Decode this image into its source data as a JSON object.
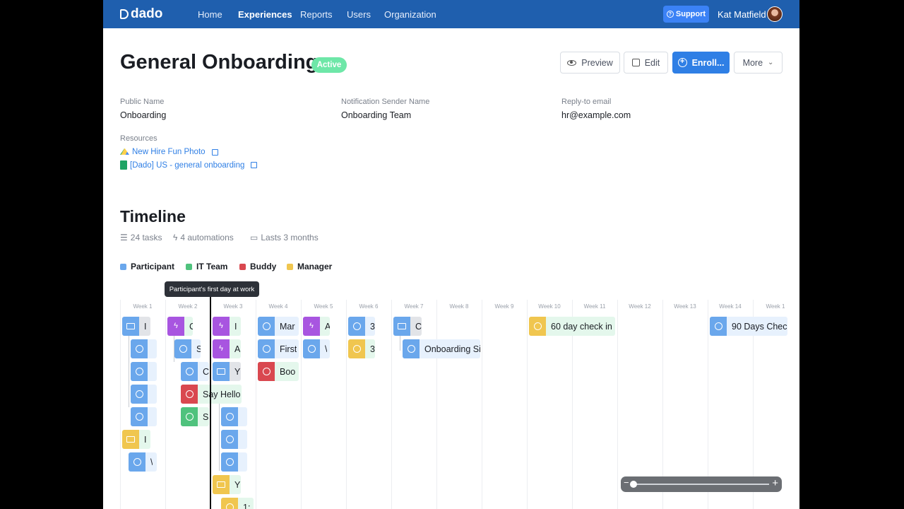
{
  "nav": {
    "brand": "dado",
    "links": [
      "Home",
      "Experiences",
      "Reports",
      "Users",
      "Organization"
    ],
    "active": "Experiences",
    "support": "Support",
    "user": "Kat Matfield"
  },
  "header": {
    "title": "General Onboarding",
    "status": "Active",
    "buttons": {
      "preview": "Preview",
      "edit": "Edit",
      "enroll": "Enroll...",
      "more": "More"
    }
  },
  "details": {
    "public_name_label": "Public Name",
    "public_name": "Onboarding",
    "sender_label": "Notification Sender Name",
    "sender": "Onboarding Team",
    "reply_label": "Reply-to email",
    "reply": "hr@example.com",
    "resources_label": "Resources",
    "resources": [
      "New Hire Fun Photo",
      "[Dado] US - general onboarding"
    ]
  },
  "timeline": {
    "title": "Timeline",
    "tasks_count": "24 tasks",
    "automations": "4 automations",
    "duration": "Lasts 3 months",
    "legend": [
      {
        "label": "Participant",
        "color": "#6aa7ec"
      },
      {
        "label": "IT Team",
        "color": "#4fc27d"
      },
      {
        "label": "Buddy",
        "color": "#d9484f"
      },
      {
        "label": "Manager",
        "color": "#f0c64f"
      }
    ],
    "today_tooltip": "Participant's first day at work",
    "weeks": [
      "Week 1",
      "Week 2",
      "Week 3",
      "Week 4",
      "Week 5",
      "Week 6",
      "Week 7",
      "Week 8",
      "Week 9",
      "Week 10",
      "Week 11",
      "Week 12",
      "Week 13",
      "Week 14",
      "Week 1"
    ],
    "task_labels": {
      "w1_mail": "I",
      "w1_mgr": "I",
      "w1_part": "\\",
      "w2_auto": "C",
      "w2_task1": "S",
      "w2_task2": "C",
      "w2_buddy": "Say Hello",
      "w2_it": "S",
      "w3_auto1": "I",
      "w3_auto2": "A",
      "w3_mail": "Y",
      "w3_mgr": "Y",
      "w3_last": "1:",
      "w4_a": "Mar",
      "w4_b": "First",
      "w4_c": "Boo",
      "w5_auto": "A",
      "w5_task": "\\",
      "w6_a": "3",
      "w6_b": "3",
      "w7_mail": "C",
      "w7_task": "Onboarding Si",
      "w10": "60 day check in",
      "w14": "90 Days Chec"
    }
  },
  "zoom": {
    "level": 0.05
  }
}
